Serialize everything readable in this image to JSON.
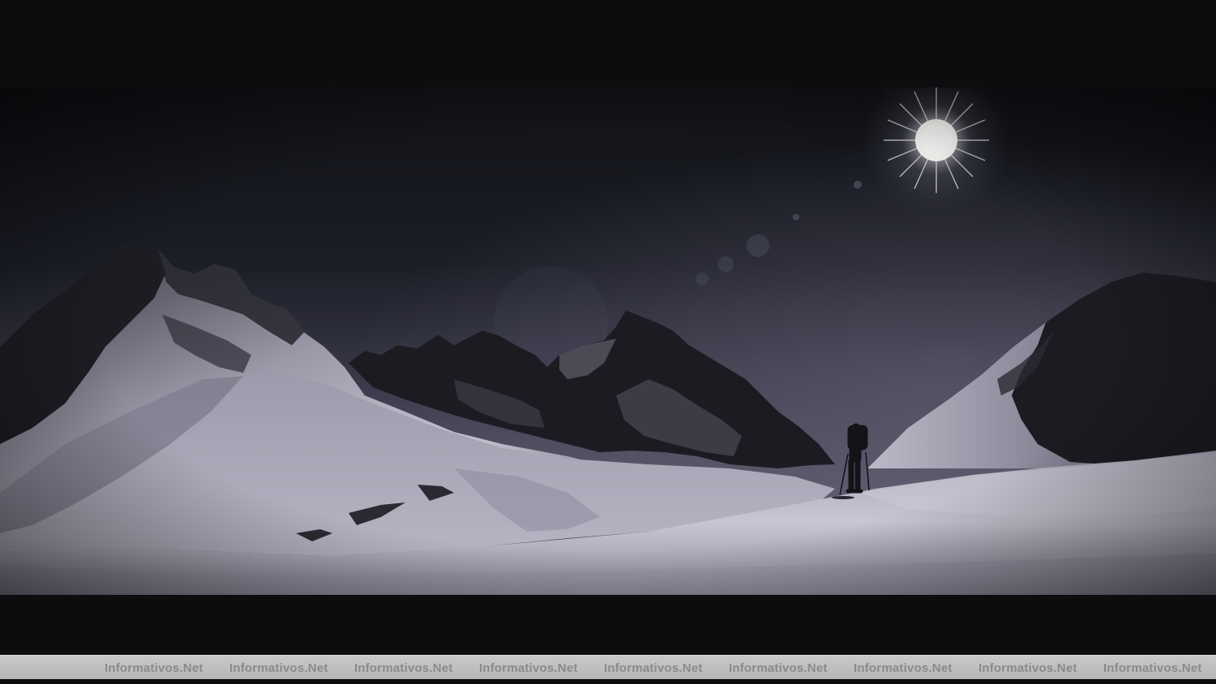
{
  "photo": {
    "subject": "",
    "sun_icon": "sun-icon",
    "figure_icon": "hiker-silhouette-icon"
  },
  "colors": {
    "sky_top": "#111318",
    "sky_horizon": "#4e4b5e",
    "snow_light": "#c9c5d3",
    "snow_shadow": "#3a3844",
    "rock": "#1a1b20",
    "letterbox": "#0d0d0f",
    "watermark_bar": "#bdbdbd",
    "watermark_text": "#8a8a8a"
  },
  "watermark": {
    "items": [
      "Informativos.Net",
      "Informativos.Net",
      "Informativos.Net",
      "Informativos.Net",
      "Informativos.Net",
      "Informativos.Net",
      "Informativos.Net",
      "Informativos.Net",
      "Informativos.Net"
    ]
  }
}
